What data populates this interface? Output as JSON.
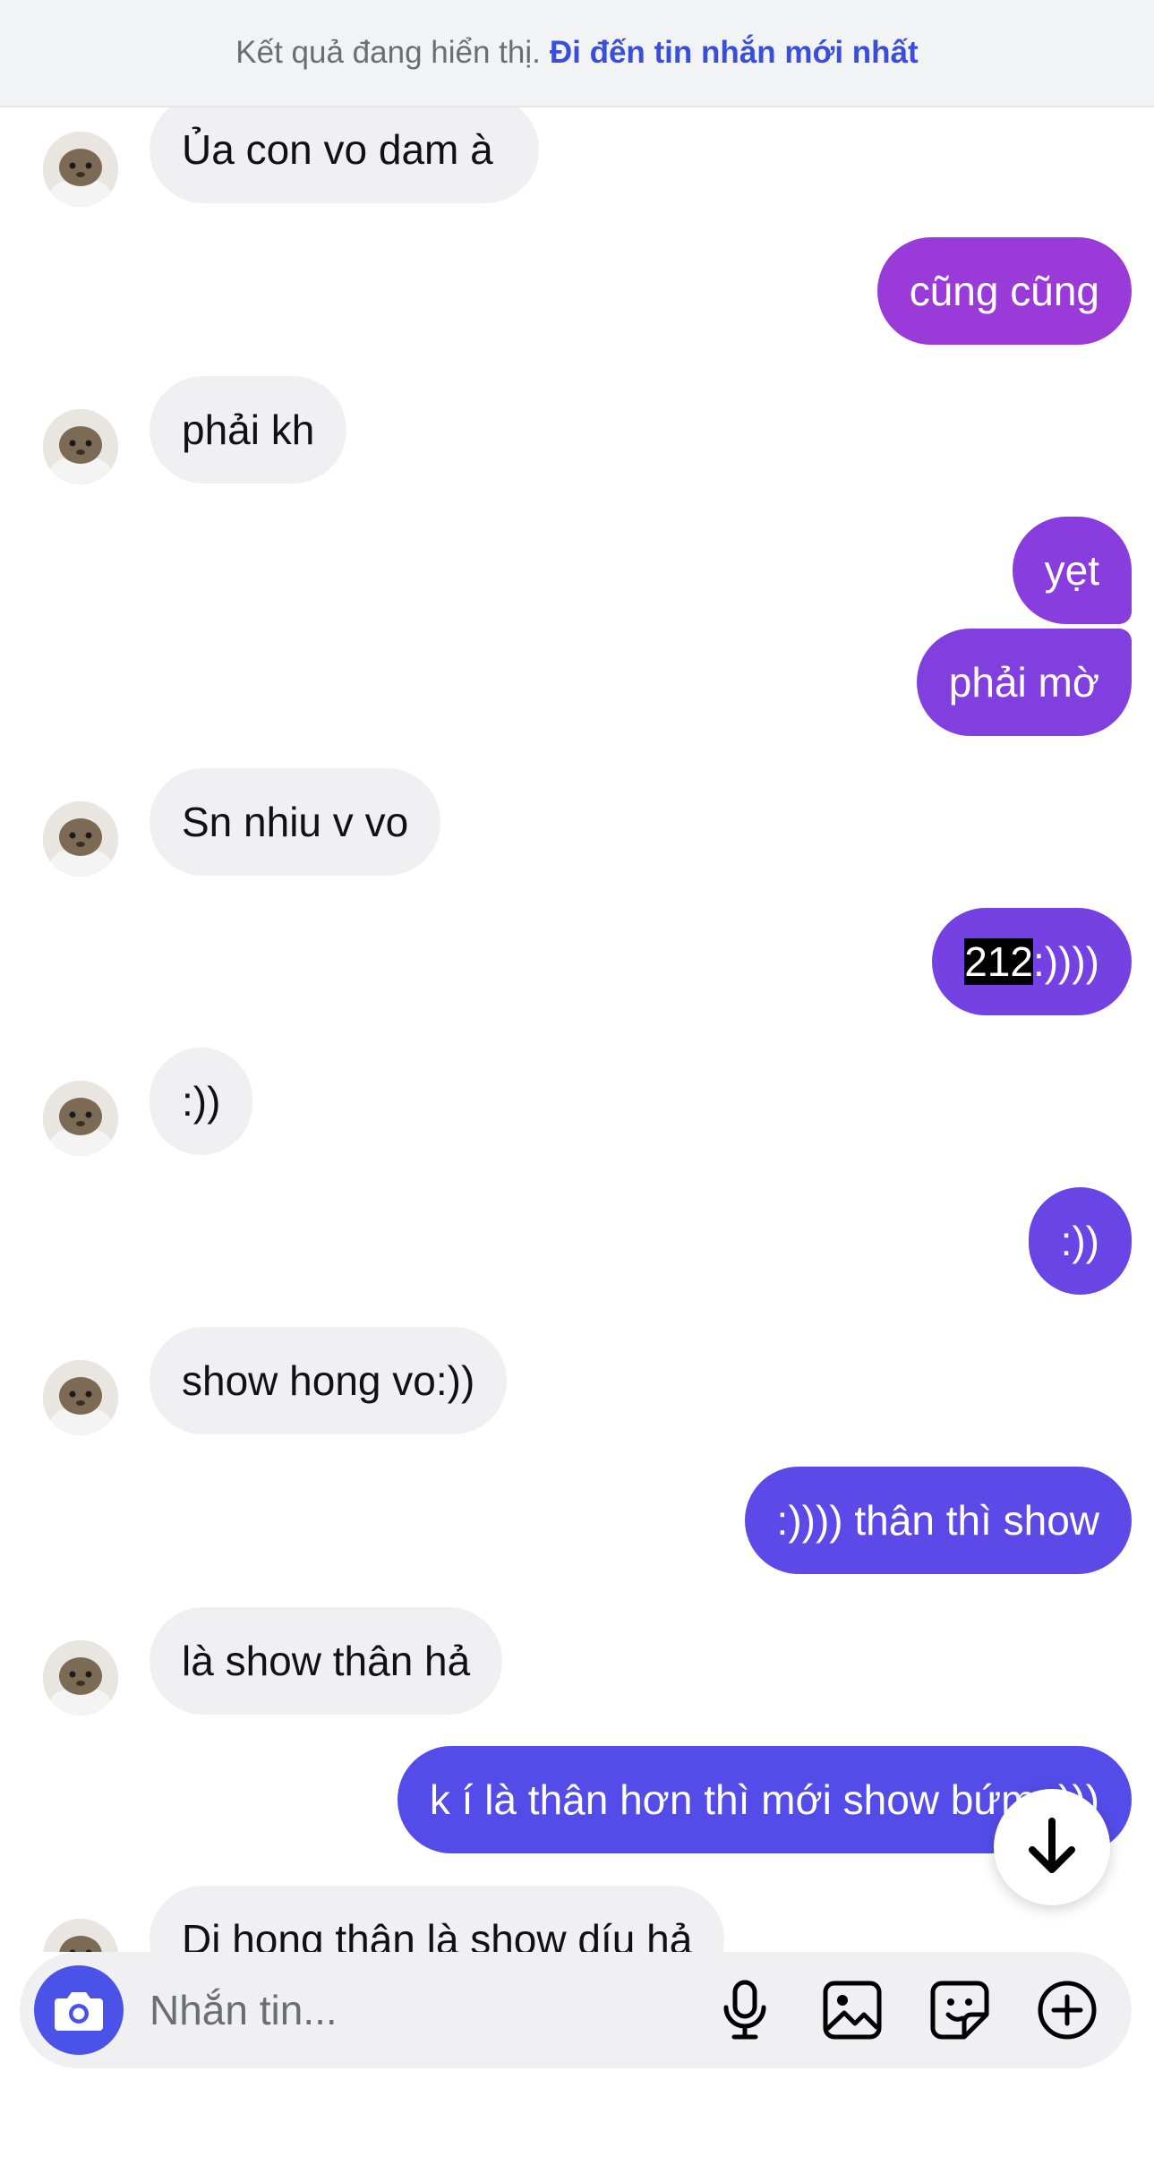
{
  "banner": {
    "info_text": "Kết quả đang hiển thị.",
    "link_text": "Đi đến tin nhắn mới nhất"
  },
  "messages": [
    {
      "side": "in",
      "text": "Ủa con vo dam à",
      "color": "#f0f0f2"
    },
    {
      "side": "out",
      "text": "cũng cũng",
      "color": "#9a3ad9"
    },
    {
      "side": "in",
      "text": "phải kh",
      "color": "#f0f0f2"
    },
    {
      "side": "out",
      "text": "yẹt",
      "color": "#8a3ddf"
    },
    {
      "side": "out",
      "text": "phải mờ",
      "color": "#823fe0"
    },
    {
      "side": "in",
      "text": "Sn nhiu v vo",
      "color": "#f0f0f2"
    },
    {
      "side": "out",
      "highlight": "212",
      "text": ":))))",
      "color": "#7641e3"
    },
    {
      "side": "in",
      "text": ":))",
      "color": "#f0f0f2"
    },
    {
      "side": "out",
      "text": ":))",
      "color": "#6a45e6"
    },
    {
      "side": "in",
      "text": "show hong vo:))",
      "color": "#f0f0f2"
    },
    {
      "side": "out",
      "text": ":)))) thân thì show",
      "color": "#5d48e8"
    },
    {
      "side": "in",
      "text": "là show thân hả",
      "color": "#f0f0f2"
    },
    {
      "side": "out",
      "text": "k í là thân hơn thì mới show bứm :)))",
      "color": "#544ce9"
    },
    {
      "side": "in",
      "text": "Di hong thân là show díu hả",
      "color": "#f0f0f2"
    }
  ],
  "composer": {
    "placeholder": "Nhắn tin...",
    "camera_icon": "camera-icon",
    "tools": [
      "microphone-icon",
      "image-icon",
      "sticker-icon",
      "add-icon"
    ]
  },
  "scroll_button_icon": "arrow-down-icon"
}
